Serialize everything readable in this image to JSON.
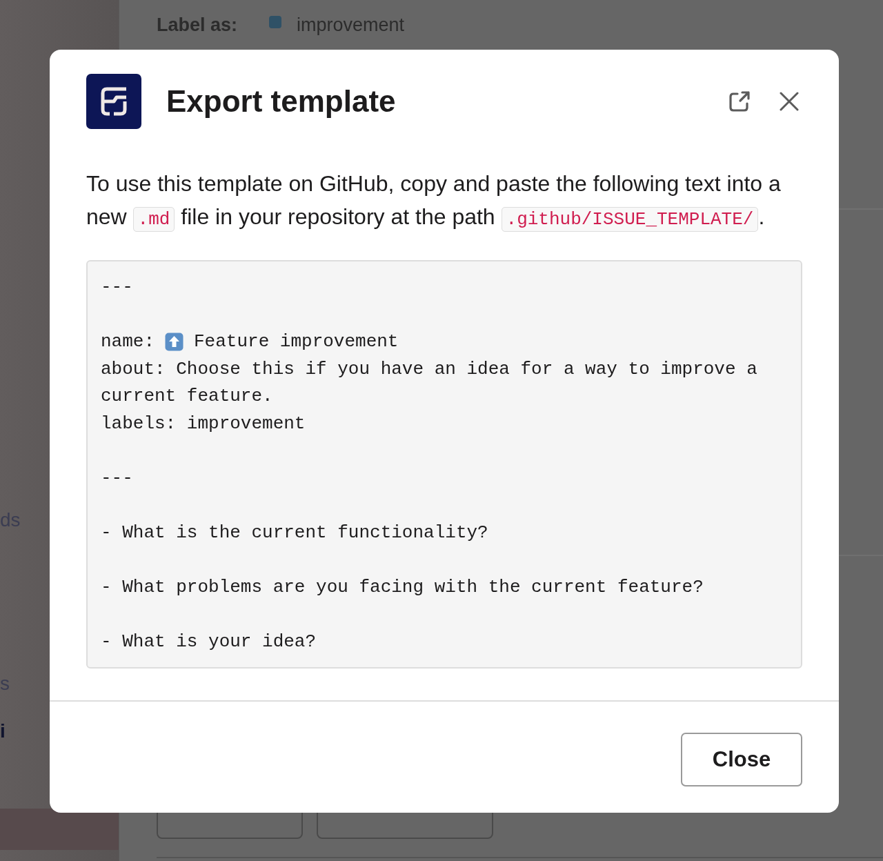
{
  "background": {
    "label_row": {
      "label": "Label as:",
      "value": "improvement"
    },
    "sidebar_items": [
      {
        "text": "ds",
        "bold": false
      },
      {
        "text": "s",
        "bold": false
      },
      {
        "text": "i",
        "bold": true
      }
    ]
  },
  "dialog": {
    "title": "Export template",
    "intro": [
      {
        "kind": "text",
        "text": "To use this template on GitHub, copy and paste the following text into a new "
      },
      {
        "kind": "code",
        "text": ".md"
      },
      {
        "kind": "text",
        "text": " file in your repository at the path "
      },
      {
        "kind": "code",
        "text": ".github/ISSUE_TEMPLATE/"
      },
      {
        "kind": "text",
        "text": "."
      }
    ],
    "code_lines": [
      {
        "blank_before": false,
        "text": "---"
      },
      {
        "blank_before": true,
        "kind": "keyed",
        "key": "name:",
        "text": "Feature improvement"
      },
      {
        "blank_before": false,
        "text": "about: Choose this if you have an idea for a way to improve a current feature."
      },
      {
        "blank_before": false,
        "text": "labels: improvement"
      },
      {
        "blank_before": true,
        "text": "---"
      },
      {
        "blank_before": true,
        "text": "- What is the current functionality?"
      },
      {
        "blank_before": true,
        "text": "- What problems are you facing with the current feature?"
      },
      {
        "blank_before": true,
        "text": "- What is your idea?"
      }
    ],
    "buttons": [
      "Close"
    ]
  }
}
